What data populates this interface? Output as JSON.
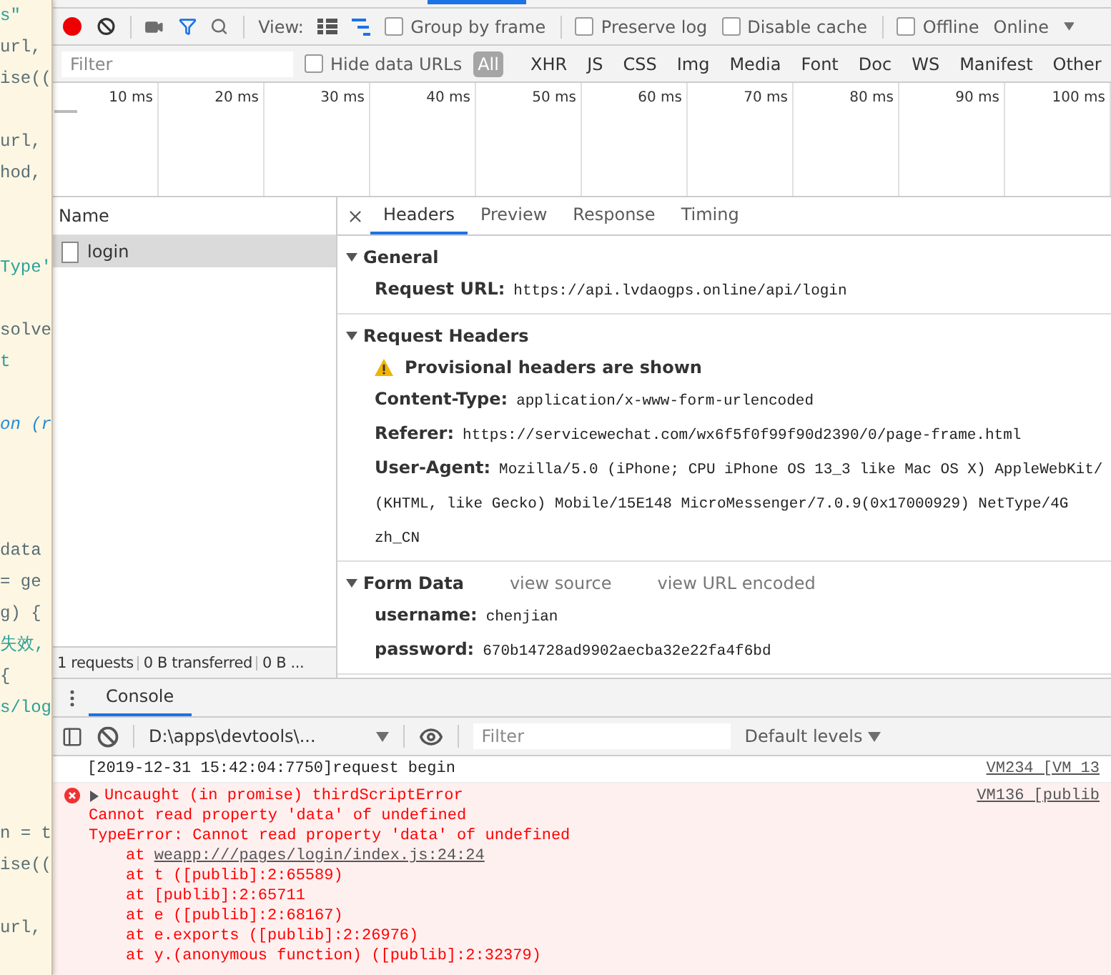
{
  "code_editor": {
    "lines": [
      {
        "kind": "string",
        "text": "s\""
      },
      {
        "kind": "plain",
        "text": "url,"
      },
      {
        "kind": "plain",
        "text": "ise(("
      },
      {
        "kind": "blank"
      },
      {
        "kind": "plain",
        "text": "url,"
      },
      {
        "kind": "plain",
        "text": "hod,"
      },
      {
        "kind": "blank"
      },
      {
        "kind": "blank"
      },
      {
        "kind": "string",
        "text": "Type'"
      },
      {
        "kind": "blank"
      },
      {
        "kind": "plain",
        "text": "solve"
      },
      {
        "kind": "string",
        "text": "t"
      },
      {
        "kind": "blank"
      },
      {
        "kind": "keyword",
        "text": "on (r"
      },
      {
        "kind": "blank"
      },
      {
        "kind": "blank"
      },
      {
        "kind": "blank"
      },
      {
        "kind": "plain",
        "text": "data"
      },
      {
        "kind": "plain",
        "text": "= ge"
      },
      {
        "kind": "plain",
        "text": "g) {"
      },
      {
        "kind": "string",
        "text": "失效,"
      },
      {
        "kind": "plain",
        "text": "{"
      },
      {
        "kind": "string",
        "text": "s/log"
      },
      {
        "kind": "blank"
      },
      {
        "kind": "blank"
      },
      {
        "kind": "blank"
      },
      {
        "kind": "plain",
        "text": "n = t"
      },
      {
        "kind": "plain",
        "text": "ise(("
      },
      {
        "kind": "blank"
      },
      {
        "kind": "plain",
        "text": "url,"
      }
    ]
  },
  "devtools": {
    "toolbar": {
      "recording": true,
      "view_label": "View:",
      "large_rows": false,
      "waterfall": true,
      "checkboxes": [
        {
          "label": "Group by frame",
          "checked": false
        },
        {
          "label": "Preserve log",
          "checked": false
        },
        {
          "label": "Disable cache",
          "checked": false
        },
        {
          "label": "Offline",
          "checked": false
        }
      ],
      "throttling": "Online"
    },
    "filter_bar": {
      "placeholder": "Filter",
      "hide_data_urls": {
        "label": "Hide data URLs",
        "checked": false
      },
      "types": [
        {
          "label": "All",
          "selected": true
        },
        {
          "label": "XHR",
          "selected": false
        },
        {
          "label": "JS",
          "selected": false
        },
        {
          "label": "CSS",
          "selected": false
        },
        {
          "label": "Img",
          "selected": false
        },
        {
          "label": "Media",
          "selected": false
        },
        {
          "label": "Font",
          "selected": false
        },
        {
          "label": "Doc",
          "selected": false
        },
        {
          "label": "WS",
          "selected": false
        },
        {
          "label": "Manifest",
          "selected": false
        },
        {
          "label": "Other",
          "selected": false
        }
      ]
    },
    "timeline": {
      "ticks": [
        "10 ms",
        "20 ms",
        "30 ms",
        "40 ms",
        "50 ms",
        "60 ms",
        "70 ms",
        "80 ms",
        "90 ms",
        "100 ms"
      ]
    },
    "requests": {
      "column": "Name",
      "rows": [
        {
          "name": "login",
          "selected": true
        }
      ],
      "summary": [
        "1 requests",
        "0 B transferred",
        "0 B ..."
      ]
    },
    "details": {
      "tabs": [
        {
          "label": "Headers",
          "selected": true
        },
        {
          "label": "Preview",
          "selected": false
        },
        {
          "label": "Response",
          "selected": false
        },
        {
          "label": "Timing",
          "selected": false
        }
      ],
      "sections": [
        {
          "title": "General",
          "expanded": true,
          "rows": [
            {
              "label": "Request URL:",
              "value": [
                "https://api.lvdaogps.online/api/login"
              ]
            }
          ]
        },
        {
          "title": "Request Headers",
          "expanded": true,
          "warning": "Provisional headers are shown",
          "rows": [
            {
              "label": "Content-Type:",
              "value": [
                "application/x-www-form-urlencoded"
              ]
            },
            {
              "label": "Referer:",
              "value": [
                "https://servicewechat.com/wx6f5f0f99f90d2390/0/page-frame.html"
              ]
            },
            {
              "label": "User-Agent:",
              "value": [
                "Mozilla/5.0 (iPhone; CPU iPhone OS 13_3 like Mac OS X) AppleWebKit/",
                "(KHTML, like Gecko) Mobile/15E148 MicroMessenger/7.0.9(0x17000929) NetType/4G",
                "zh_CN"
              ]
            }
          ]
        },
        {
          "title": "Form Data",
          "expanded": true,
          "links": [
            "view source",
            "view URL encoded"
          ],
          "rows": [
            {
              "label": "username:",
              "value": [
                "chenjian"
              ]
            },
            {
              "label": "password:",
              "value": [
                "670b14728ad9902aecba32e22fa4f6bd"
              ]
            }
          ]
        }
      ]
    }
  },
  "drawer": {
    "tabs": [
      {
        "label": "Console",
        "selected": true
      }
    ],
    "context": "D:\\apps\\devtools\\...",
    "filter_placeholder": "Filter",
    "levels": "Default levels",
    "messages": [
      {
        "kind": "log",
        "text": "[2019-12-31 15:42:04:7750]request begin",
        "source": "VM234 [VM 13"
      },
      {
        "kind": "error",
        "expanded": false,
        "text": "Uncaught (in promise) thirdScriptError",
        "lines": [
          "Cannot read property 'data' of undefined",
          "TypeError: Cannot read property 'data' of undefined"
        ],
        "stack": [
          {
            "text": "at",
            "link": "weapp:///pages/login/index.js:24:24"
          },
          {
            "text": "at t ([publib]:2:65589)"
          },
          {
            "text": "at [publib]:2:65711"
          },
          {
            "text": "at e ([publib]:2:68167)"
          },
          {
            "text": "at e.exports ([publib]:2:26976)"
          },
          {
            "text": "at y.(anonymous function) ([publib]:2:32379)"
          }
        ],
        "source": "VM136 [publib"
      }
    ]
  }
}
